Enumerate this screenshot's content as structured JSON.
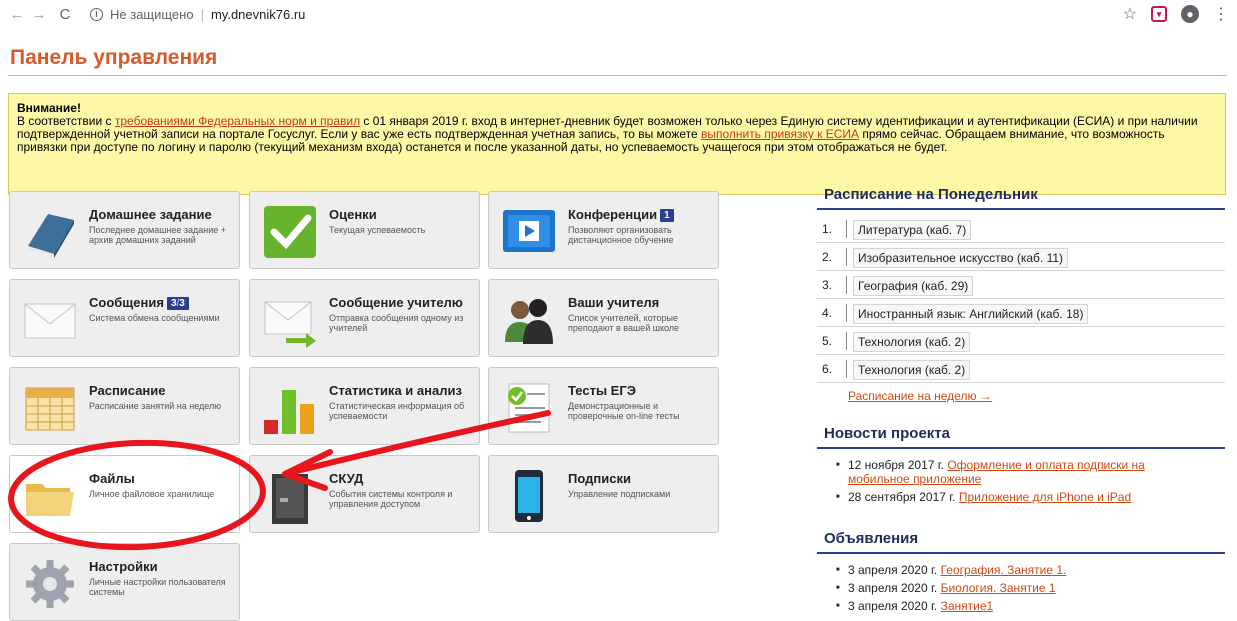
{
  "browser": {
    "security_text": "Не защищено",
    "url": "my.dnevnik76.ru"
  },
  "page": {
    "title": "Панель управления"
  },
  "warning": {
    "title": "Внимание!",
    "t1": "В соответствии с ",
    "link1": "требованиями Федеральных норм и правил",
    "t2": " с 01 января 2019 г. вход в интернет-дневник будет возможен только через Единую систему идентификации и аутентификации (ЕСИА) и при наличии подтвержденной учетной записи на портале Госуслуг. Если у вас уже есть подтвержденная учетная запись, то вы можете ",
    "link2": "выполнить привязку к ЕСИА",
    "t3": " прямо сейчас. Обращаем внимание, что возможность привязки при доступе по логину и паролю (текущий механизм входа) останется и после указанной даты, но успеваемость учащегося при этом отображаться не будет."
  },
  "tiles": {
    "homework": {
      "title": "Домашнее задание",
      "desc": "Последнее домашнее задание + архив домашних заданий"
    },
    "grades": {
      "title": "Оценки",
      "desc": "Текущая успеваемость"
    },
    "conferences": {
      "title": "Конференции",
      "badge": "1",
      "desc": "Позволяют организовать дистанционное обучение"
    },
    "messages": {
      "title": "Сообщения",
      "badge_a": "3",
      "badge_sep": "/",
      "badge_b": "3",
      "desc": "Система обмена сообщениями"
    },
    "message_teacher": {
      "title": "Сообщение учителю",
      "desc": "Отправка сообщения одному из учителей"
    },
    "teachers": {
      "title": "Ваши учителя",
      "desc": "Список учителей, которые преподают в вашей школе"
    },
    "schedule": {
      "title": "Расписание",
      "desc": "Расписание занятий на неделю"
    },
    "stats": {
      "title": "Статистика и анализ",
      "desc": "Статистическая информация об успеваемости"
    },
    "tests": {
      "title": "Тесты ЕГЭ",
      "desc": "Демонстрационные и проверочные on-line тесты"
    },
    "files": {
      "title": "Файлы",
      "desc": "Личное файловое хранилище"
    },
    "skud": {
      "title": "СКУД",
      "desc": "События системы контроля и управления доступом"
    },
    "subscriptions": {
      "title": "Подписки",
      "desc": "Управление подписками"
    },
    "settings": {
      "title": "Настройки",
      "desc": "Личные настройки пользователя системы"
    }
  },
  "schedule_panel": {
    "title": "Расписание на Понедельник",
    "items": [
      {
        "num": "1.",
        "name": "Литература (каб. 7)"
      },
      {
        "num": "2.",
        "name": "Изобразительное искусство (каб. 11)"
      },
      {
        "num": "3.",
        "name": "География (каб. 29)"
      },
      {
        "num": "4.",
        "name": "Иностранный язык: Английский (каб. 18)"
      },
      {
        "num": "5.",
        "name": "Технология (каб. 2)"
      },
      {
        "num": "6.",
        "name": "Технология (каб. 2)"
      }
    ],
    "week_link": "Расписание на неделю →"
  },
  "news": {
    "title": "Новости проекта",
    "items": [
      {
        "date": "12 ноября 2017 г.",
        "link": "Оформление и оплата подписки на мобильное приложение"
      },
      {
        "date": "28 сентября 2017 г.",
        "link": "Приложение для iPhone и iPad"
      }
    ]
  },
  "ads": {
    "title": "Объявления",
    "items": [
      {
        "date": "3 апреля 2020 г.",
        "link": "География. Занятие 1."
      },
      {
        "date": "3 апреля 2020 г.",
        "link": "Биология. Занятие 1"
      },
      {
        "date": "3 апреля 2020 г.",
        "link": "Занятие1"
      }
    ]
  },
  "colors": {
    "title_orange": "#d8592a",
    "link_orange": "#d04a14",
    "badge_navy": "#2a3f8f",
    "warning_yellow": "#fcf8a6",
    "annotation_red": "#e8141e"
  }
}
